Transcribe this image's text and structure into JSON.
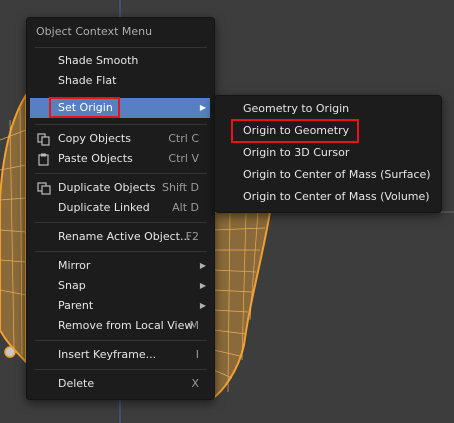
{
  "menu": {
    "title": "Object Context Menu",
    "groups": [
      [
        {
          "label": "Shade Smooth",
          "shortcut": ""
        },
        {
          "label": "Shade Flat",
          "shortcut": ""
        }
      ],
      [
        {
          "label": "Set Origin",
          "shortcut": "",
          "submenu": true,
          "active": true
        }
      ],
      [
        {
          "label": "Copy Objects",
          "shortcut": "Ctrl C",
          "icon": "copy-icon"
        },
        {
          "label": "Paste Objects",
          "shortcut": "Ctrl V",
          "icon": "paste-icon"
        }
      ],
      [
        {
          "label": "Duplicate Objects",
          "shortcut": "Shift D",
          "icon": "duplicate-icon"
        },
        {
          "label": "Duplicate Linked",
          "shortcut": "Alt D"
        }
      ],
      [
        {
          "label": "Rename Active Object...",
          "shortcut": "F2"
        }
      ],
      [
        {
          "label": "Mirror",
          "shortcut": "",
          "submenu": true
        },
        {
          "label": "Snap",
          "shortcut": "",
          "submenu": true
        },
        {
          "label": "Parent",
          "shortcut": "",
          "submenu": true
        },
        {
          "label": "Remove from Local View",
          "shortcut": "M"
        }
      ],
      [
        {
          "label": "Insert Keyframe...",
          "shortcut": "I"
        }
      ],
      [
        {
          "label": "Delete",
          "shortcut": "X"
        }
      ]
    ]
  },
  "submenu": {
    "items": [
      {
        "label": "Geometry to Origin"
      },
      {
        "label": "Origin to Geometry"
      },
      {
        "label": "Origin to 3D Cursor"
      },
      {
        "label": "Origin to Center of Mass (Surface)"
      },
      {
        "label": "Origin to Center of Mass (Volume)"
      }
    ]
  },
  "colors": {
    "background": "#3d3d3d",
    "menu_bg": "#1c1c1c",
    "active_item": "#5680c2",
    "highlight_box": "#e8141c",
    "wireframe": "#e8952a",
    "axis_line": "#3f5f9a"
  }
}
